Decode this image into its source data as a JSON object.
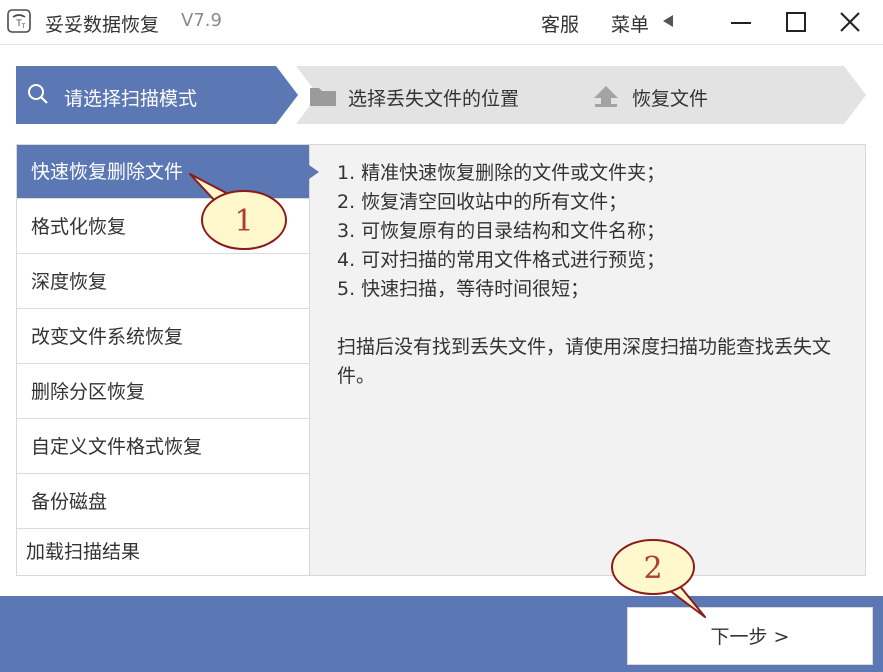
{
  "title_bar": {
    "app_title": "妥妥数据恢复",
    "version": "V7.9",
    "support_label": "客服",
    "menu_label": "菜单",
    "icons": [
      "app-logo-icon",
      "menu-arrow-icon",
      "minimize-icon",
      "maximize-icon",
      "close-icon"
    ]
  },
  "steps": [
    {
      "label": "请选择扫描模式",
      "icon": "search-icon",
      "active": true
    },
    {
      "label": "选择丢失文件的位置",
      "icon": "folder-icon",
      "active": false
    },
    {
      "label": "恢复文件",
      "icon": "upload-icon",
      "active": false
    }
  ],
  "modes": [
    {
      "label": "快速恢复删除文件",
      "active": true
    },
    {
      "label": "格式化恢复",
      "active": false
    },
    {
      "label": "深度恢复",
      "active": false
    },
    {
      "label": "改变文件系统恢复",
      "active": false
    },
    {
      "label": "删除分区恢复",
      "active": false
    },
    {
      "label": "自定义文件格式恢复",
      "active": false
    },
    {
      "label": "备份磁盘",
      "active": false
    },
    {
      "label": "加载扫描结果",
      "active": false
    }
  ],
  "description": {
    "lines": [
      "1. 精准快速恢复删除的文件或文件夹；",
      "2. 恢复清空回收站中的所有文件；",
      "3. 可恢复原有的目录结构和文件名称；",
      "4. 可对扫描的常用文件格式进行预览；",
      "5. 快速扫描，等待时间很短；"
    ],
    "note": "扫描后没有找到丢失文件，请使用深度扫描功能查找丢失文件。"
  },
  "next_button": {
    "label": "下一步 >"
  },
  "callouts": [
    {
      "number": "1"
    },
    {
      "number": "2"
    }
  ],
  "colors": {
    "accent": "#5b77b4",
    "inactive_step": "#e3e3e3",
    "panel_bg": "#f2f2f2",
    "callout_fill": "#fff8cc",
    "callout_stroke": "#8b1a1a",
    "callout_text": "#b23a2e"
  }
}
